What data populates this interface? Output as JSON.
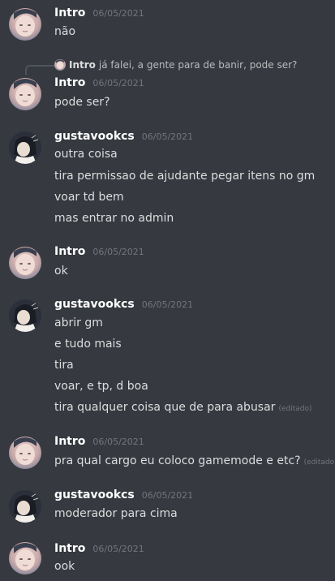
{
  "users": {
    "intro": "Intro",
    "gustavo": "gustavookcs"
  },
  "messages": [
    {
      "author": "Intro",
      "timestamp": "06/05/2021",
      "lines": [
        "não"
      ]
    },
    {
      "reply": {
        "author": "Intro",
        "text": "já falei, a gente para de banir, pode ser?"
      },
      "author": "Intro",
      "timestamp": "06/05/2021",
      "lines": [
        "pode ser?"
      ]
    },
    {
      "author": "gustavookcs",
      "timestamp": "06/05/2021",
      "lines": [
        "outra coisa",
        "tira permissao de ajudante pegar itens no gm",
        "voar td bem",
        "mas entrar no admin"
      ]
    },
    {
      "author": "Intro",
      "timestamp": "06/05/2021",
      "lines": [
        "ok"
      ]
    },
    {
      "author": "gustavookcs",
      "timestamp": "06/05/2021",
      "lines": [
        "abrir gm",
        "e tudo mais",
        "tira",
        "voar, e tp, d boa",
        "tira qualquer coisa que de para abusar"
      ],
      "edited_label": "(editado)"
    },
    {
      "author": "Intro",
      "timestamp": "06/05/2021",
      "lines": [
        "pra qual cargo eu coloco gamemode e etc?"
      ],
      "edited_label": "(editado)"
    },
    {
      "author": "gustavookcs",
      "timestamp": "06/05/2021",
      "lines": [
        "moderador para cima"
      ]
    },
    {
      "author": "Intro",
      "timestamp": "06/05/2021",
      "lines": [
        "ook"
      ]
    }
  ],
  "colors": {
    "background": "#36393f",
    "username": "#ffffff",
    "text": "#dcddde",
    "timestamp": "#72767d"
  }
}
